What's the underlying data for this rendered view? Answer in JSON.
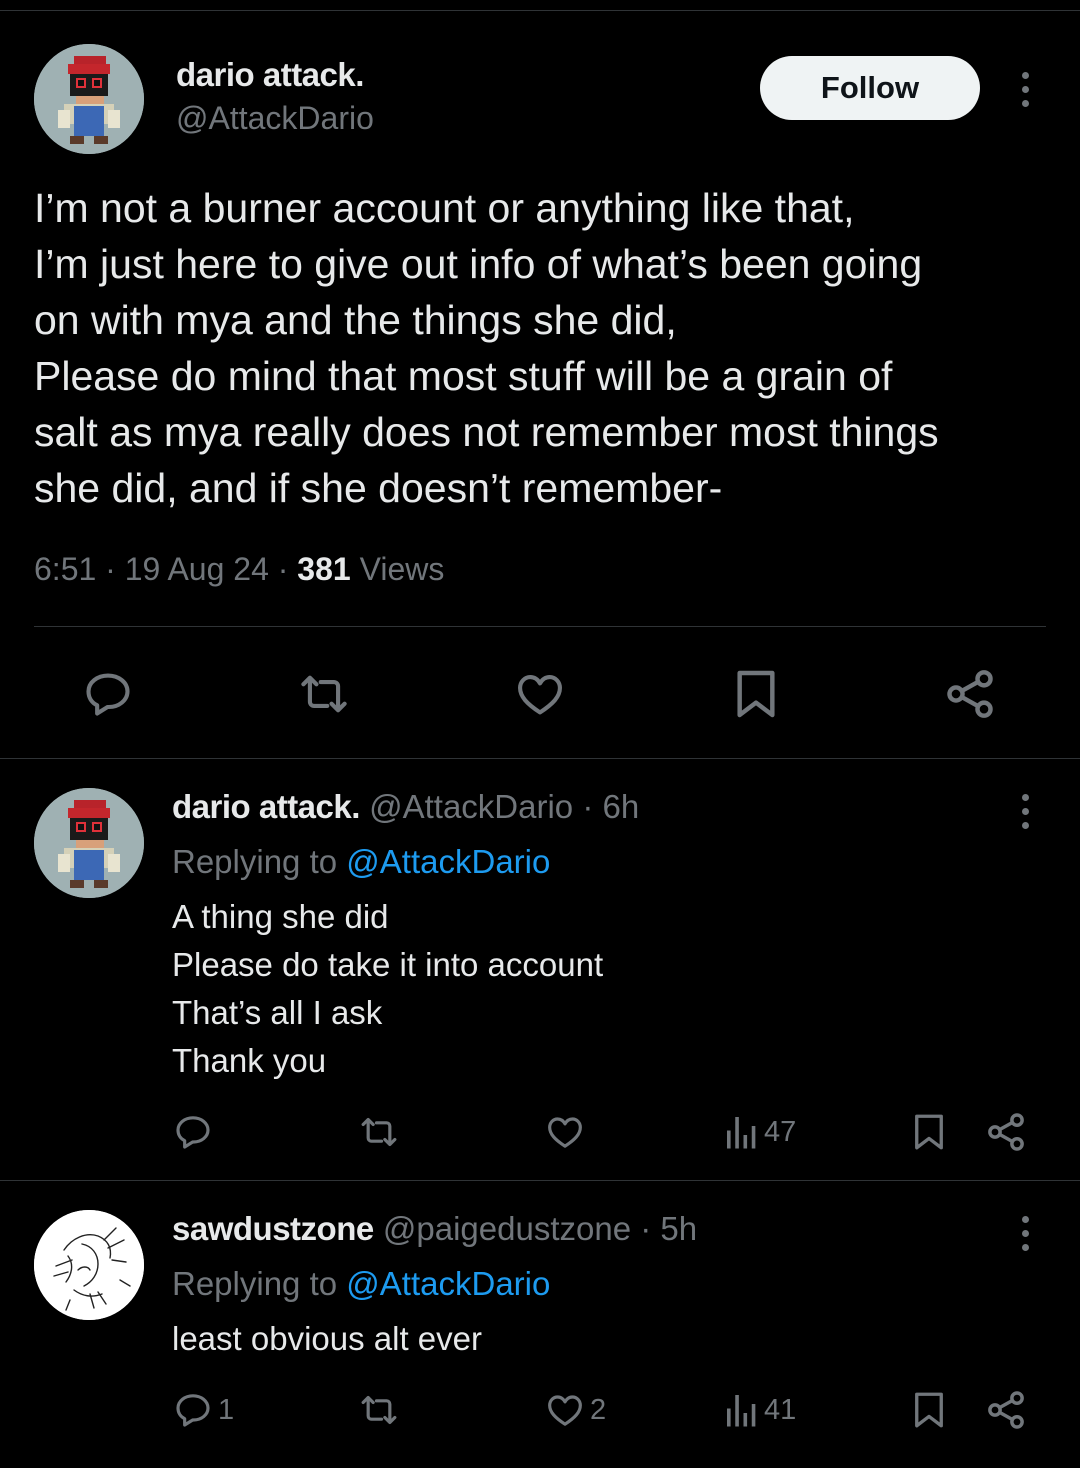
{
  "main_tweet": {
    "author_name": "dario attack.",
    "author_handle": "@AttackDario",
    "follow_label": "Follow",
    "text_lines": [
      "I’m not a burner account or anything like that,",
      "I’m just here to give out info of what’s been going",
      "on with mya and the things she did,",
      "Please do mind that most stuff will be a grain of",
      "salt as mya really does not remember most things",
      "she did, and if she doesn’t remember-"
    ],
    "time": "6:51",
    "date": "19 Aug 24",
    "views_count": "381",
    "views_label": "Views",
    "sep": " · "
  },
  "replies": [
    {
      "author_name": "dario attack.",
      "author_handle": "@AttackDario",
      "age": "6h",
      "replying_prefix": "Replying to",
      "replying_to": "@AttackDario",
      "text_lines": [
        "A thing she did",
        "Please do take it into account",
        "That’s all I ask",
        "Thank you"
      ],
      "reply_count": "",
      "like_count": "",
      "view_count": "47"
    },
    {
      "author_name": "sawdustzone",
      "author_handle": "@paigedustzone",
      "age": "5h",
      "replying_prefix": "Replying to",
      "replying_to": "@AttackDario",
      "text_lines": [
        "least obvious alt ever"
      ],
      "reply_count": "1",
      "like_count": "2",
      "view_count": "41"
    }
  ],
  "colors": {
    "background": "#000000",
    "text_primary": "#e7e9ea",
    "text_secondary": "#71767b",
    "link": "#1d9bf0",
    "divider": "#2f3336",
    "follow_bg": "#eff3f4"
  }
}
